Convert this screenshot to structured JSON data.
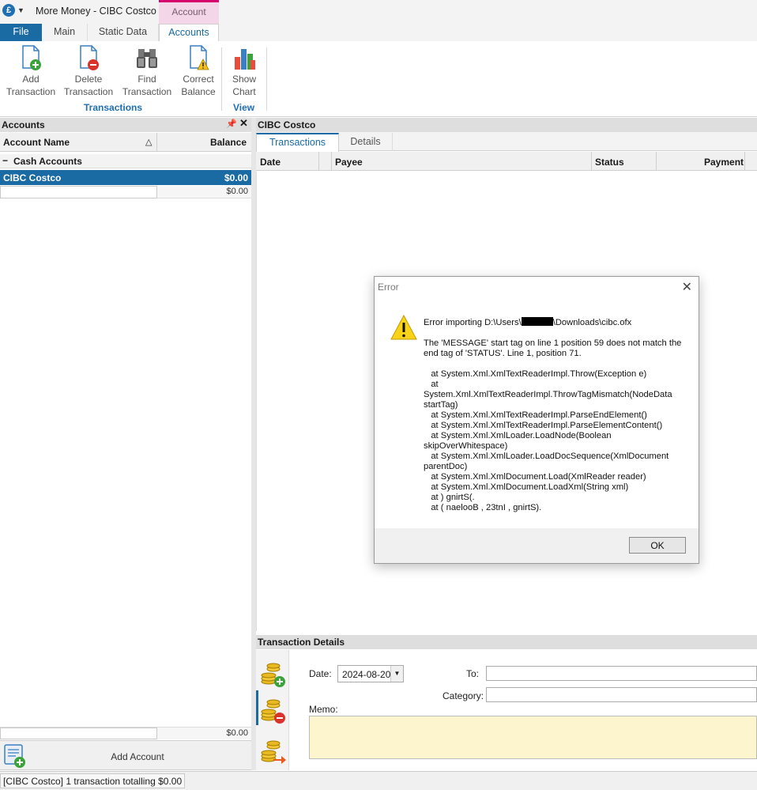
{
  "window": {
    "app_icon": "£",
    "title": "More Money - CIBC Costco",
    "context_tab": "Account"
  },
  "ribbon": {
    "tabs": [
      "File",
      "Main",
      "Static Data",
      "Accounts"
    ],
    "buttons": {
      "add_transaction": [
        "Add",
        "Transaction"
      ],
      "delete_transaction": [
        "Delete",
        "Transaction"
      ],
      "find_transaction": [
        "Find",
        "Transaction"
      ],
      "correct_balance": [
        "Correct",
        "Balance"
      ],
      "show_chart": [
        "Show",
        "Chart"
      ]
    },
    "groups": {
      "transactions": "Transactions",
      "view": "View"
    }
  },
  "accounts_panel": {
    "title": "Accounts",
    "col_name": "Account Name",
    "col_balance": "Balance",
    "group_toggle": "−",
    "group_label": "Cash Accounts",
    "rows": [
      {
        "name": "CIBC Costco",
        "balance": "$0.00"
      }
    ],
    "new_row_balance": "$0.00",
    "total_balance": "$0.00",
    "add_account": "Add Account"
  },
  "account_view": {
    "title": "CIBC Costco",
    "tabs": [
      "Transactions",
      "Details"
    ],
    "columns": [
      "Date",
      "Payee",
      "Status",
      "Payment"
    ]
  },
  "transaction_details": {
    "title": "Transaction Details",
    "date_label": "Date:",
    "date_value": "2024-08-20",
    "to_label": "To:",
    "category_label": "Category:",
    "memo_label": "Memo:"
  },
  "status_bar": {
    "text": "[CIBC Costco] 1 transaction totalling $0.00"
  },
  "dialog": {
    "title": "Error",
    "msg_prefix": "Error importing D:\\Users\\",
    "msg_suffix": "\\Downloads\\cibc.ofx",
    "detail": "The 'MESSAGE' start tag on line 1 position 59 does not match the end tag of 'STATUS'. Line 1, position 71.",
    "stack": "   at System.Xml.XmlTextReaderImpl.Throw(Exception e)\n   at\nSystem.Xml.XmlTextReaderImpl.ThrowTagMismatch(NodeData\nstartTag)\n   at System.Xml.XmlTextReaderImpl.ParseEndElement()\n   at System.Xml.XmlTextReaderImpl.ParseElementContent()\n   at System.Xml.XmlLoader.LoadNode(Boolean\nskipOverWhitespace)\n   at System.Xml.XmlLoader.LoadDocSequence(XmlDocument\nparentDoc)\n   at System.Xml.XmlDocument.Load(XmlReader reader)\n   at System.Xml.XmlDocument.LoadXml(String xml)\n   at ) gnirtS(.\n   at ( naelooB , 23tnI , gnirtS).",
    "ok": "OK"
  },
  "colors": {
    "accent": "#1a6aa3",
    "context_tab": "#d6006f",
    "memo_bg": "#fdf5cd"
  }
}
